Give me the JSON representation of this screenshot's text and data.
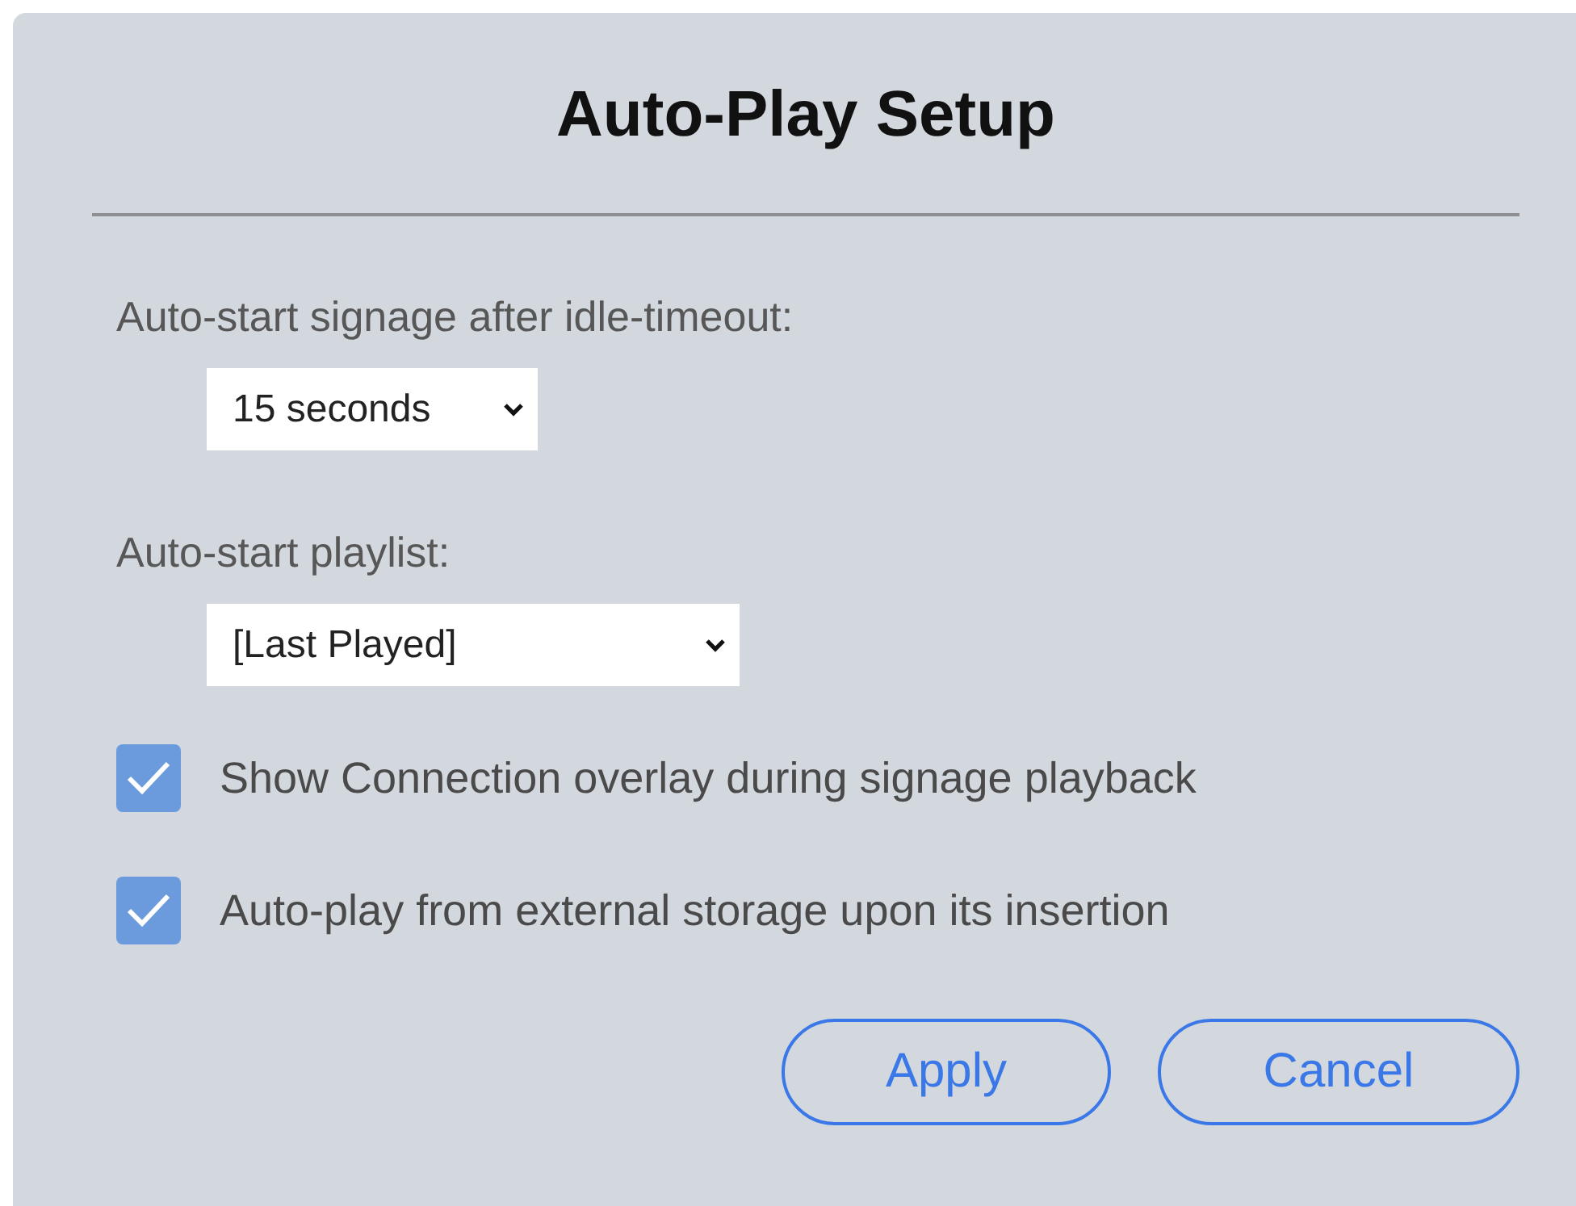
{
  "dialog": {
    "title": "Auto-Play Setup",
    "fields": [
      {
        "label": "Auto-start signage after idle-timeout:",
        "value": "15 seconds"
      },
      {
        "label": "Auto-start playlist:",
        "value": "[Last Played]"
      }
    ],
    "options": [
      {
        "label": "Show Connection overlay during signage playback",
        "checked": true
      },
      {
        "label": "Auto-play from external storage upon its insertion",
        "checked": true
      }
    ],
    "buttons": [
      "Apply",
      "Cancel"
    ]
  }
}
